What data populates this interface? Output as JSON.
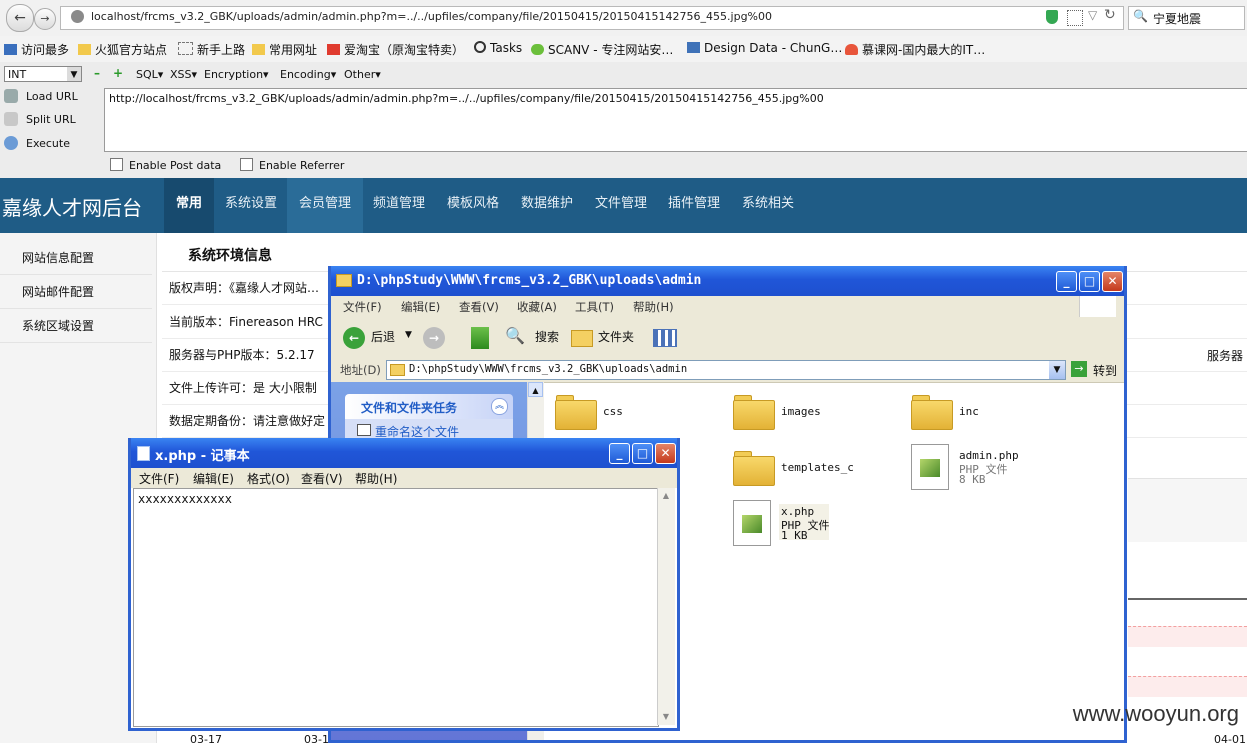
{
  "browser": {
    "url": "localhost/frcms_v3.2_GBK/uploads/admin/admin.php?m=../../upfiles/company/file/20150415/20150415142756_455.jpg%00",
    "search_value": "宁夏地震"
  },
  "bookmarks": [
    "访问最多",
    "火狐官方站点",
    "新手上路",
    "常用网址",
    "爱淘宝（原淘宝特卖）",
    "Tasks",
    "SCANV - 专注网站安…",
    "Design Data - ChunG…",
    "慕课网-国内最大的IT…"
  ],
  "hackbar": {
    "select_value": "INT",
    "menus": [
      "SQL▾",
      "XSS▾",
      "Encryption▾",
      "Encoding▾",
      "Other▾"
    ],
    "buttons": [
      "Load URL",
      "Split URL",
      "Execute"
    ],
    "url_text": "http://localhost/frcms_v3.2_GBK/uploads/admin/admin.php?m=../../upfiles/company/file/20150415/20150415142756_455.jpg%00",
    "post_label": "Enable Post data",
    "referrer_label": "Enable Referrer"
  },
  "admin": {
    "brand": "嘉缘人才网后台",
    "nav": [
      "常用",
      "系统设置",
      "会员管理",
      "频道管理",
      "模板风格",
      "数据维护",
      "文件管理",
      "插件管理",
      "系统相关"
    ],
    "sidebar": [
      "网站信息配置",
      "网站邮件配置",
      "系统区域设置"
    ],
    "section_title": "系统环境信息",
    "rows": [
      "版权声明：《嘉缘人才网站…",
      "当前版本：Finereason HRC",
      "服务器与PHP版本：5.2.17",
      "文件上传许可：是  大小限制",
      "数据定期备份：请注意做好定"
    ],
    "right_label": "服务器",
    "chart_ticks": [
      "03-17",
      "03-1",
      "04-01"
    ]
  },
  "explorer": {
    "title": "D:\\phpStudy\\WWW\\frcms_v3.2_GBK\\uploads\\admin",
    "menus": [
      "文件(F)",
      "编辑(E)",
      "查看(V)",
      "收藏(A)",
      "工具(T)",
      "帮助(H)"
    ],
    "back": "后退",
    "search": "搜索",
    "folders_btn": "文件夹",
    "address_label": "地址(D)",
    "address": "D:\\phpStudy\\WWW\\frcms_v3.2_GBK\\uploads\\admin",
    "go": "转到",
    "task_title": "文件和文件夹任务",
    "task_item": "重命名这个文件",
    "items": {
      "css": "css",
      "images": "images",
      "inc": "inc",
      "templates": "templates_c",
      "admin_php": "admin.php",
      "admin_type": "PHP 文件",
      "admin_size": "8 KB",
      "x_php": "x.php",
      "x_type": "PHP 文件",
      "x_size": "1 KB"
    }
  },
  "notepad": {
    "title": "x.php - 记事本",
    "menus": [
      "文件(F)",
      "编辑(E)",
      "格式(O)",
      "查看(V)",
      "帮助(H)"
    ],
    "content": "xxxxxxxxxxxxx"
  },
  "watermark": "www.wooyun.org",
  "colors": {
    "admin_header": "#1f5c86",
    "xp_title": "#2056d8",
    "xp_bg": "#ece9d8"
  }
}
